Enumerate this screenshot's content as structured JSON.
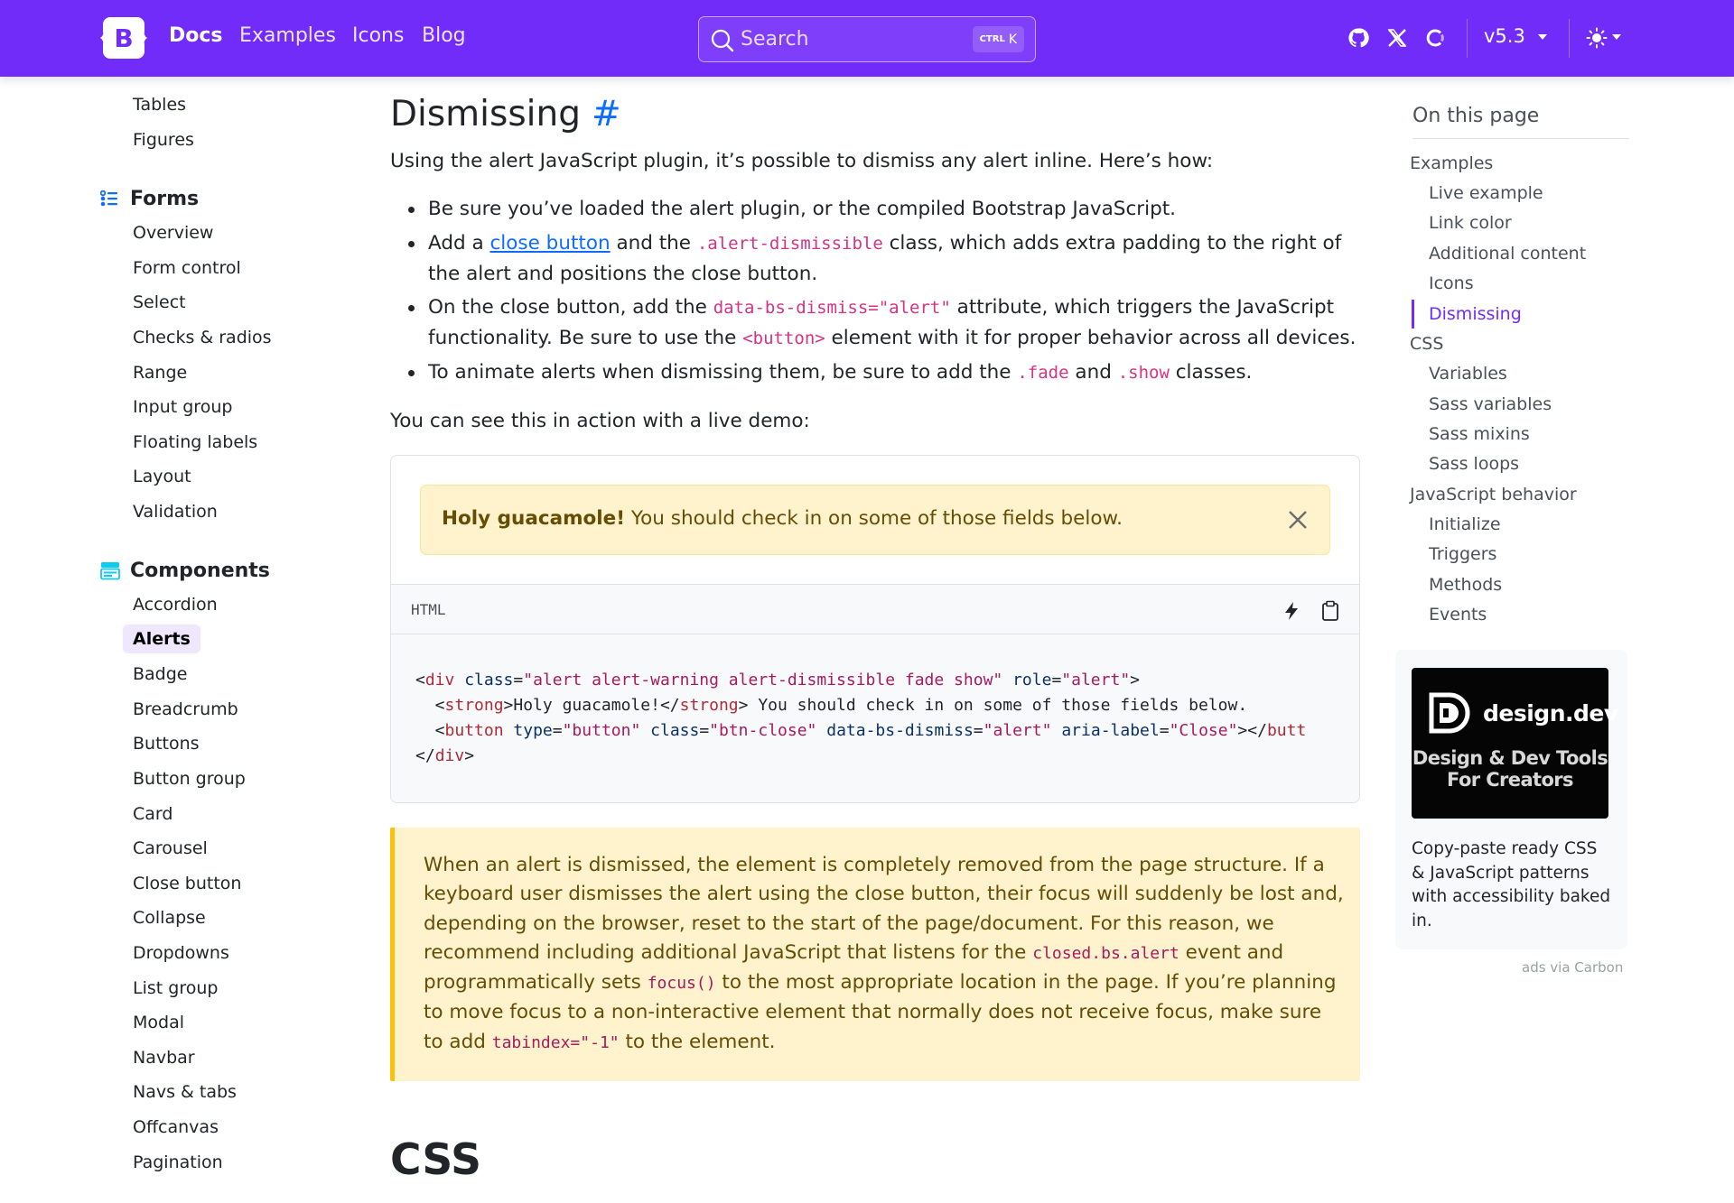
{
  "navbar": {
    "brand_letter": "B",
    "links": [
      "Docs",
      "Examples",
      "Icons",
      "Blog"
    ],
    "search_placeholder": "Search",
    "search_shortcut_ctrl": "CTRL",
    "search_shortcut_key": "K",
    "version": "v5.3",
    "icons": [
      "github-icon",
      "x-icon",
      "opencollective-icon",
      "sun-icon"
    ],
    "accent_color": "#712cf9"
  },
  "sidebar": {
    "top_items": [
      "Tables",
      "Figures"
    ],
    "forms_heading": "Forms",
    "forms_items": [
      "Overview",
      "Form control",
      "Select",
      "Checks & radios",
      "Range",
      "Input group",
      "Floating labels",
      "Layout",
      "Validation"
    ],
    "components_heading": "Components",
    "components_items": [
      "Accordion",
      "Alerts",
      "Badge",
      "Breadcrumb",
      "Buttons",
      "Button group",
      "Card",
      "Carousel",
      "Close button",
      "Collapse",
      "Dropdowns",
      "List group",
      "Modal",
      "Navbar",
      "Navs & tabs",
      "Offcanvas",
      "Pagination"
    ],
    "active_item": "Alerts"
  },
  "main": {
    "heading": "Dismissing",
    "anchor": "#",
    "intro": "Using the alert JavaScript plugin, it’s possible to dismiss any alert inline. Here’s how:",
    "bullets": {
      "b1": "Be sure you’ve loaded the alert plugin, or the compiled Bootstrap JavaScript.",
      "b2_pre": "Add a ",
      "b2_link": "close button",
      "b2_mid": " and the ",
      "b2_code": ".alert-dismissible",
      "b2_post": " class, which adds extra padding to the right of",
      "b2_line2": "the alert and positions the close button.",
      "b3_pre": "On the close button, add the ",
      "b3_code": "data-bs-dismiss=\"alert\"",
      "b3_post": " attribute, which triggers the JavaScript",
      "b3_line2_pre": "functionality. Be sure to use the ",
      "b3_line2_code": "<button>",
      "b3_line2_post": " element with it for proper behavior across all devices.",
      "b4_pre": "To animate alerts when dismissing them, be sure to add the ",
      "b4_code1": ".fade",
      "b4_mid": " and ",
      "b4_code2": ".show",
      "b4_post": " classes."
    },
    "demo_intro": "You can see this in action with a live demo:",
    "alert_strong": "Holy guacamole!",
    "alert_text": " You should check in on some of those fields below.",
    "code_lang": "HTML",
    "code_lines": [
      "<div class=\"alert alert-warning alert-dismissible fade show\" role=\"alert\">",
      "  <strong>Holy guacamole!</strong> You should check in on some of those fields below.",
      "  <button type=\"button\" class=\"btn-close\" data-bs-dismiss=\"alert\" aria-label=\"Close\"></butt",
      "</div>"
    ],
    "callout": {
      "l1": "When an alert is dismissed, the element is completely removed from the page structure. If a",
      "l2": "keyboard user dismisses the alert using the close button, their focus will suddenly be lost and,",
      "l3": "depending on the browser, reset to the start of the page/document. For this reason, we",
      "l4_pre": "recommend including additional JavaScript that listens for the ",
      "l4_code": "closed.bs.alert",
      "l4_post": " event and",
      "l5_pre": "programmatically sets ",
      "l5_code": "focus()",
      "l5_post": " to the most appropriate location in the page. If you’re planning",
      "l6": "to move focus to a non-interactive element that normally does not receive focus, make sure",
      "l7_pre": "to add ",
      "l7_code": "tabindex=\"-1\"",
      "l7_post": " to the element."
    },
    "next_heading": "CSS"
  },
  "toc": {
    "title": "On this page",
    "items": [
      {
        "label": "Examples",
        "level": 1
      },
      {
        "label": "Live example",
        "level": 2
      },
      {
        "label": "Link color",
        "level": 2
      },
      {
        "label": "Additional content",
        "level": 2
      },
      {
        "label": "Icons",
        "level": 2
      },
      {
        "label": "Dismissing",
        "level": 2
      },
      {
        "label": "CSS",
        "level": 1
      },
      {
        "label": "Variables",
        "level": 2
      },
      {
        "label": "Sass variables",
        "level": 2
      },
      {
        "label": "Sass mixins",
        "level": 2
      },
      {
        "label": "Sass loops",
        "level": 2
      },
      {
        "label": "JavaScript behavior",
        "level": 1
      },
      {
        "label": "Initialize",
        "level": 2
      },
      {
        "label": "Triggers",
        "level": 2
      },
      {
        "label": "Methods",
        "level": 2
      },
      {
        "label": "Events",
        "level": 2
      }
    ],
    "active": "Dismissing"
  },
  "ad": {
    "brand": "design.dev",
    "tagline_1": "Design & Dev Tools",
    "tagline_2": "For Creators",
    "text": "Copy-paste ready CSS & JavaScript patterns with accessibility baked in.",
    "via": "ads via Carbon"
  }
}
